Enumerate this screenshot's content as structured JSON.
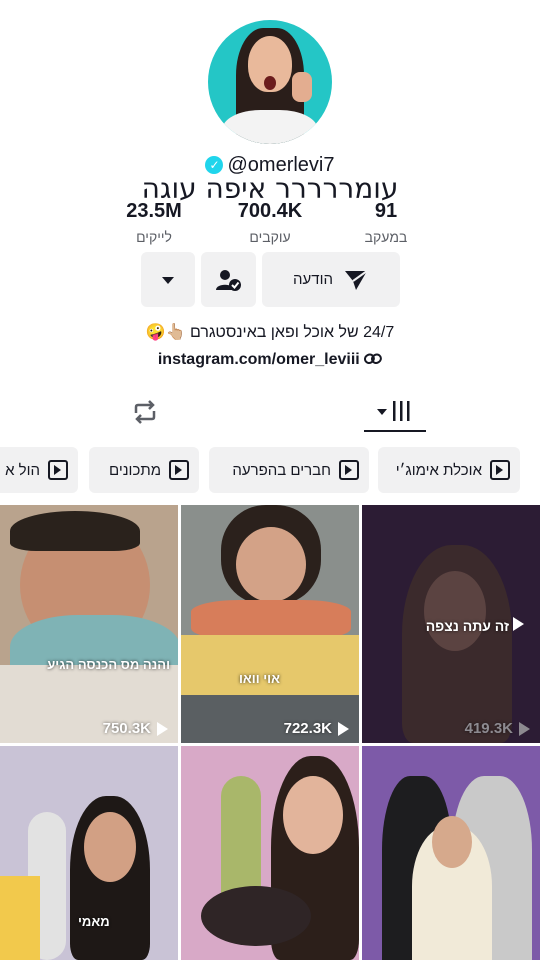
{
  "profile": {
    "handle": "@omerlevi7",
    "display_name": "עומררררר איפה עוגה",
    "stats": [
      {
        "value": "23.5M",
        "label": "לייקים"
      },
      {
        "value": "700.4K",
        "label": "עוקבים"
      },
      {
        "value": "91",
        "label": "במעקב"
      }
    ],
    "bio": "24/7 של אוכל ופאן באינסטגרם 👆🏼🤪",
    "link": "instagram.com/omer_leviii"
  },
  "buttons": {
    "message_label": "הודעה"
  },
  "playlists": [
    "אוכלת אימוג׳י",
    "חברים בהפרעה",
    "מתכונים",
    "הול א"
  ],
  "videos": [
    {
      "views": "750.3K",
      "caption": "והנה מס הכנסה הגיע",
      "bg": "#b9a38d"
    },
    {
      "views": "722.3K",
      "caption": "אוי וואו",
      "bg": "#8a8f8c"
    },
    {
      "views": "419.3K",
      "caption": "זה עתה נצפה",
      "bg": "#2c1c34"
    },
    {
      "views": "",
      "caption": "מאמי",
      "bg": "#c9c3d6"
    },
    {
      "views": "",
      "caption": "",
      "bg": "#d8a9c7"
    },
    {
      "views": "",
      "caption": "",
      "bg": "#7d5aa8"
    }
  ],
  "colors": {
    "accent": "#20d5ec",
    "avatar_bg": "#24c6c6",
    "button_bg": "#f1f1f2"
  }
}
